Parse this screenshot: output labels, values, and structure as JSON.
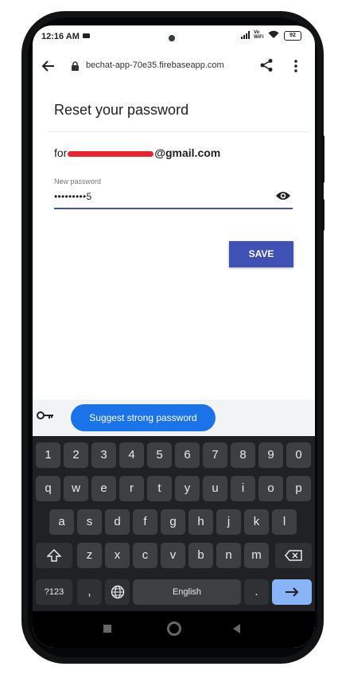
{
  "status": {
    "time": "12:16 AM",
    "vowifi_top": "Vo",
    "vowifi_bottom": "WiFi",
    "battery": "92"
  },
  "browser": {
    "url": "bechat-app-70e35.firebaseapp.com"
  },
  "page": {
    "title": "Reset your password",
    "email_prefix": "for",
    "email_domain": "@gmail.com",
    "password_label": "New password",
    "password_value": "•••••••••5",
    "save_label": "SAVE"
  },
  "autofill": {
    "suggest_label": "Suggest strong password"
  },
  "keyboard": {
    "row_numbers": [
      "1",
      "2",
      "3",
      "4",
      "5",
      "6",
      "7",
      "8",
      "9",
      "0"
    ],
    "row_q": [
      "q",
      "w",
      "e",
      "r",
      "t",
      "y",
      "u",
      "i",
      "o",
      "p"
    ],
    "row_a": [
      "a",
      "s",
      "d",
      "f",
      "g",
      "h",
      "j",
      "k",
      "l"
    ],
    "row_z": [
      "z",
      "x",
      "c",
      "v",
      "b",
      "n",
      "m"
    ],
    "symbols_label": "?123",
    "comma_label": ",",
    "space_label": "English",
    "period_label": ".",
    "shift_icon": "shift-icon",
    "backspace_icon": "backspace-icon",
    "globe_icon": "globe-icon",
    "enter_icon": "arrow-right-icon"
  },
  "colors": {
    "accent": "#3f51b5",
    "chip": "#1a73e8",
    "redaction": "#e8252d",
    "enter_key": "#8ab4f8"
  }
}
